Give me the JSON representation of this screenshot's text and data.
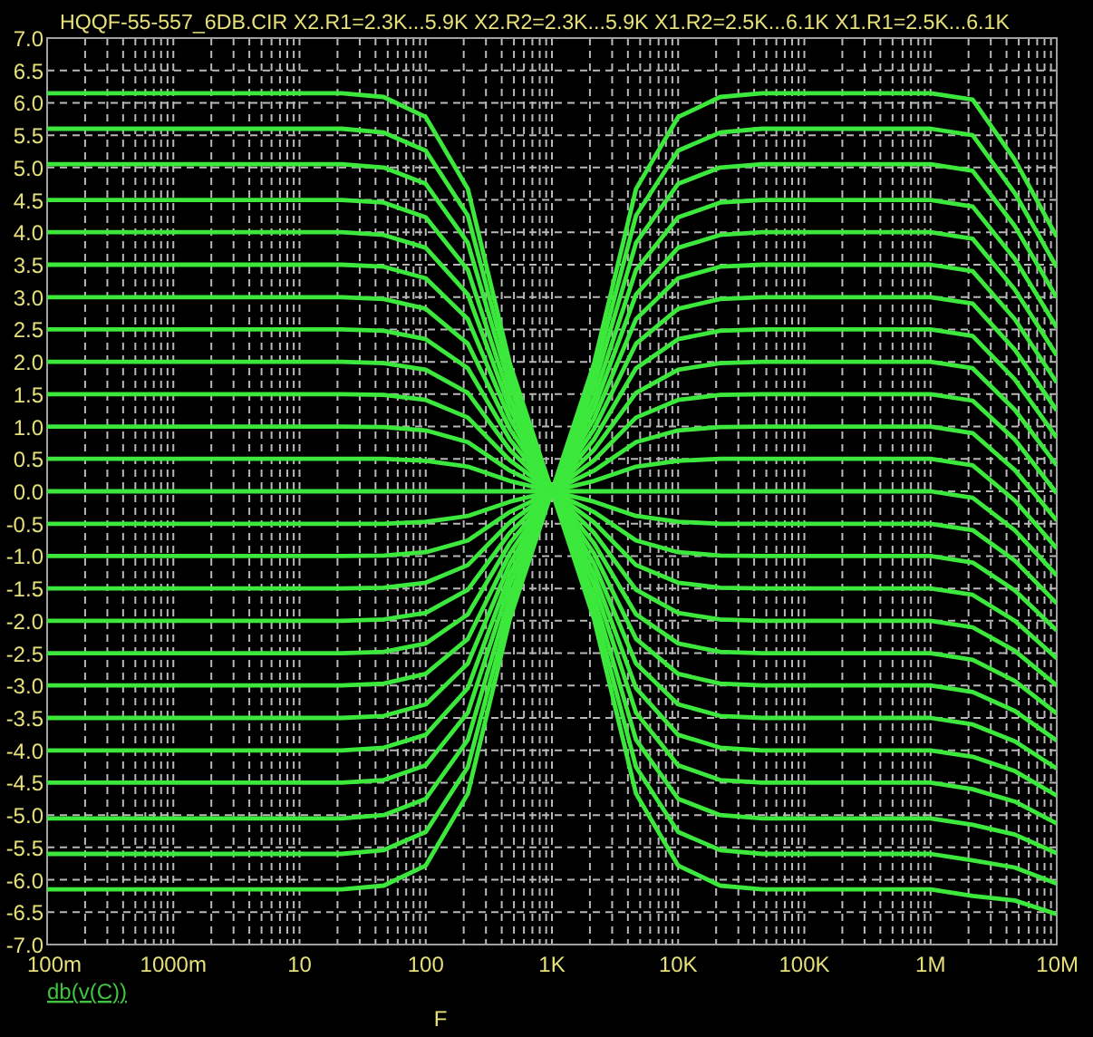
{
  "plot": {
    "chart_data": {
      "type": "line",
      "title": "HQQF-55-557_6DB.CIR X2.R1=2.3K...5.9K X2.R2=2.3K...5.9K X1.R2=2.5K...6.1K X1.R1=2.5K...6.1K",
      "xlabel": "F",
      "grid": true,
      "categories": [
        "100m",
        null,
        null,
        "1000m",
        null,
        null,
        "10",
        null,
        null,
        "100",
        null,
        null,
        "1K",
        null,
        null,
        "10K",
        null,
        null,
        "100K",
        null,
        null,
        "1M",
        null,
        null,
        "10M"
      ],
      "ylim": [
        -7,
        7
      ],
      "yticks": [
        {
          "value": 7,
          "label": "7.0"
        },
        {
          "value": 6.5,
          "label": "6.5"
        },
        {
          "value": 6,
          "label": "6.0"
        },
        {
          "value": 5.5,
          "label": "5.5"
        },
        {
          "value": 5,
          "label": "5.0"
        },
        {
          "value": 4.5,
          "label": "4.5"
        },
        {
          "value": 4,
          "label": "4.0"
        },
        {
          "value": 3.5,
          "label": "3.5"
        },
        {
          "value": 3,
          "label": "3.0"
        },
        {
          "value": 2.5,
          "label": "2.5"
        },
        {
          "value": 2,
          "label": "2.0"
        },
        {
          "value": 1.5,
          "label": "1.5"
        },
        {
          "value": 1,
          "label": "1.0"
        },
        {
          "value": 0.5,
          "label": "0.5"
        },
        {
          "value": 0,
          "label": "0.0"
        },
        {
          "value": -0.5,
          "label": "-0.5"
        },
        {
          "value": -1,
          "label": "-1.0"
        },
        {
          "value": -1.5,
          "label": "-1.5"
        },
        {
          "value": -2,
          "label": "-2.0"
        },
        {
          "value": -2.5,
          "label": "-2.5"
        },
        {
          "value": -3,
          "label": "-3.0"
        },
        {
          "value": -3.5,
          "label": "-3.5"
        },
        {
          "value": -4,
          "label": "-4.0"
        },
        {
          "value": -4.5,
          "label": "-4.5"
        },
        {
          "value": -5,
          "label": "-5.0"
        },
        {
          "value": -5.5,
          "label": "-5.5"
        },
        {
          "value": -6,
          "label": "-6.0"
        },
        {
          "value": -6.5,
          "label": "-6.5"
        },
        {
          "value": -7,
          "label": "-7.0"
        }
      ],
      "series": [
        {
          "color": "#3be83b",
          "values": [
            6.15,
            6.15,
            6.15,
            6.15,
            6.15,
            6.15,
            6.15,
            6.15,
            6.09,
            5.78,
            4.67,
            1.97,
            0,
            1.97,
            4.67,
            5.78,
            6.09,
            6.15,
            6.15,
            6.15,
            6.15,
            6.15,
            6.05,
            5.12,
            3.93
          ]
        },
        {
          "color": "#3be83b",
          "values": [
            5.6,
            5.6,
            5.6,
            5.6,
            5.6,
            5.6,
            5.6,
            5.6,
            5.54,
            5.26,
            4.26,
            1.79,
            0,
            1.79,
            4.26,
            5.26,
            5.54,
            5.6,
            5.6,
            5.6,
            5.6,
            5.6,
            5.5,
            4.61,
            3.46
          ]
        },
        {
          "color": "#3be83b",
          "values": [
            5.05,
            5.05,
            5.05,
            5.05,
            5.05,
            5.05,
            5.05,
            5.05,
            5.0,
            4.75,
            3.84,
            1.62,
            0,
            1.62,
            3.84,
            4.75,
            5.0,
            5.05,
            5.05,
            5.05,
            5.05,
            5.05,
            4.95,
            4.1,
            2.99
          ]
        },
        {
          "color": "#3be83b",
          "values": [
            4.5,
            4.5,
            4.5,
            4.5,
            4.5,
            4.5,
            4.5,
            4.5,
            4.46,
            4.23,
            3.42,
            1.44,
            0,
            1.44,
            3.42,
            4.23,
            4.46,
            4.5,
            4.5,
            4.5,
            4.5,
            4.5,
            4.4,
            3.59,
            2.53
          ]
        },
        {
          "color": "#3be83b",
          "values": [
            4,
            4,
            4,
            4,
            4,
            4,
            4,
            4,
            3.96,
            3.76,
            3.04,
            1.28,
            0,
            1.28,
            3.04,
            3.76,
            3.96,
            4,
            4,
            4,
            4,
            4,
            3.9,
            3.12,
            2.1
          ]
        },
        {
          "color": "#3be83b",
          "values": [
            3.5,
            3.5,
            3.5,
            3.5,
            3.5,
            3.5,
            3.5,
            3.5,
            3.47,
            3.29,
            2.66,
            1.12,
            0,
            1.12,
            2.66,
            3.29,
            3.47,
            3.5,
            3.5,
            3.5,
            3.5,
            3.5,
            3.4,
            2.66,
            1.68
          ]
        },
        {
          "color": "#3be83b",
          "values": [
            3,
            3,
            3,
            3,
            3,
            3,
            3,
            3,
            2.97,
            2.82,
            2.28,
            0.96,
            0,
            0.96,
            2.28,
            2.82,
            2.97,
            3,
            3,
            3,
            3,
            3,
            2.9,
            2.19,
            1.25
          ]
        },
        {
          "color": "#3be83b",
          "values": [
            2.5,
            2.5,
            2.5,
            2.5,
            2.5,
            2.5,
            2.5,
            2.5,
            2.48,
            2.35,
            1.9,
            0.8,
            0,
            0.8,
            1.9,
            2.35,
            2.48,
            2.5,
            2.5,
            2.5,
            2.5,
            2.5,
            2.4,
            1.73,
            0.83
          ]
        },
        {
          "color": "#3be83b",
          "values": [
            2,
            2,
            2,
            2,
            2,
            2,
            2,
            2,
            1.98,
            1.88,
            1.52,
            0.64,
            0,
            0.64,
            1.52,
            1.88,
            1.98,
            2,
            2,
            2,
            2,
            2,
            1.9,
            1.26,
            0.4
          ]
        },
        {
          "color": "#3be83b",
          "values": [
            1.5,
            1.5,
            1.5,
            1.5,
            1.5,
            1.5,
            1.5,
            1.5,
            1.49,
            1.41,
            1.14,
            0.48,
            0,
            0.48,
            1.14,
            1.41,
            1.49,
            1.5,
            1.5,
            1.5,
            1.5,
            1.5,
            1.4,
            0.8,
            -0.03
          ]
        },
        {
          "color": "#3be83b",
          "values": [
            1,
            1,
            1,
            1,
            1,
            1,
            1,
            1,
            0.99,
            0.94,
            0.76,
            0.32,
            0,
            0.32,
            0.76,
            0.94,
            0.99,
            1,
            1,
            1,
            1,
            1,
            0.9,
            0.33,
            -0.45
          ]
        },
        {
          "color": "#3be83b",
          "values": [
            0.5,
            0.5,
            0.5,
            0.5,
            0.5,
            0.5,
            0.5,
            0.5,
            0.5,
            0.47,
            0.38,
            0.16,
            0,
            0.16,
            0.38,
            0.47,
            0.5,
            0.5,
            0.5,
            0.5,
            0.5,
            0.5,
            0.4,
            -0.14,
            -0.88
          ]
        },
        {
          "color": "#3be83b",
          "values": [
            0,
            0,
            0,
            0,
            0,
            0,
            0,
            0,
            0,
            0,
            0,
            0,
            0,
            0,
            0,
            0,
            0,
            0,
            0,
            0,
            0,
            0,
            -0.1,
            -0.6,
            -1.3
          ]
        },
        {
          "color": "#3be83b",
          "values": [
            -0.5,
            -0.5,
            -0.5,
            -0.5,
            -0.5,
            -0.5,
            -0.5,
            -0.5,
            -0.5,
            -0.47,
            -0.38,
            -0.16,
            0,
            -0.16,
            -0.38,
            -0.47,
            -0.5,
            -0.5,
            -0.5,
            -0.5,
            -0.5,
            -0.5,
            -0.6,
            -1.07,
            -1.73
          ]
        },
        {
          "color": "#3be83b",
          "values": [
            -1,
            -1,
            -1,
            -1,
            -1,
            -1,
            -1,
            -1,
            -0.99,
            -0.94,
            -0.76,
            -0.32,
            0,
            -0.32,
            -0.76,
            -0.94,
            -0.99,
            -1,
            -1,
            -1,
            -1,
            -1,
            -1.1,
            -1.53,
            -2.15
          ]
        },
        {
          "color": "#3be83b",
          "values": [
            -1.5,
            -1.5,
            -1.5,
            -1.5,
            -1.5,
            -1.5,
            -1.5,
            -1.5,
            -1.49,
            -1.41,
            -1.14,
            -0.48,
            0,
            -0.48,
            -1.14,
            -1.41,
            -1.49,
            -1.5,
            -1.5,
            -1.5,
            -1.5,
            -1.5,
            -1.6,
            -2.0,
            -2.58
          ]
        },
        {
          "color": "#3be83b",
          "values": [
            -2,
            -2,
            -2,
            -2,
            -2,
            -2,
            -2,
            -2,
            -1.98,
            -1.88,
            -1.52,
            -0.64,
            0,
            -0.64,
            -1.52,
            -1.88,
            -1.98,
            -2,
            -2,
            -2,
            -2,
            -2,
            -2.1,
            -2.46,
            -3.0
          ]
        },
        {
          "color": "#3be83b",
          "values": [
            -2.5,
            -2.5,
            -2.5,
            -2.5,
            -2.5,
            -2.5,
            -2.5,
            -2.5,
            -2.48,
            -2.35,
            -1.9,
            -0.8,
            0,
            -0.8,
            -1.9,
            -2.35,
            -2.48,
            -2.5,
            -2.5,
            -2.5,
            -2.5,
            -2.5,
            -2.6,
            -2.93,
            -3.43
          ]
        },
        {
          "color": "#3be83b",
          "values": [
            -3,
            -3,
            -3,
            -3,
            -3,
            -3,
            -3,
            -3,
            -2.97,
            -2.82,
            -2.28,
            -0.96,
            0,
            -0.96,
            -2.28,
            -2.82,
            -2.97,
            -3,
            -3,
            -3,
            -3,
            -3,
            -3.1,
            -3.39,
            -3.85
          ]
        },
        {
          "color": "#3be83b",
          "values": [
            -3.5,
            -3.5,
            -3.5,
            -3.5,
            -3.5,
            -3.5,
            -3.5,
            -3.5,
            -3.47,
            -3.29,
            -2.66,
            -1.12,
            0,
            -1.12,
            -2.66,
            -3.29,
            -3.47,
            -3.5,
            -3.5,
            -3.5,
            -3.5,
            -3.5,
            -3.6,
            -3.86,
            -4.28
          ]
        },
        {
          "color": "#3be83b",
          "values": [
            -4,
            -4,
            -4,
            -4,
            -4,
            -4,
            -4,
            -4,
            -3.96,
            -3.76,
            -3.04,
            -1.28,
            0,
            -1.28,
            -3.04,
            -3.76,
            -3.96,
            -4,
            -4,
            -4,
            -4,
            -4,
            -4.1,
            -4.32,
            -4.7
          ]
        },
        {
          "color": "#3be83b",
          "values": [
            -4.5,
            -4.5,
            -4.5,
            -4.5,
            -4.5,
            -4.5,
            -4.5,
            -4.5,
            -4.46,
            -4.23,
            -3.42,
            -1.44,
            0,
            -1.44,
            -3.42,
            -4.23,
            -4.46,
            -4.5,
            -4.5,
            -4.5,
            -4.5,
            -4.5,
            -4.6,
            -4.79,
            -5.13
          ]
        },
        {
          "color": "#3be83b",
          "values": [
            -5.05,
            -5.05,
            -5.05,
            -5.05,
            -5.05,
            -5.05,
            -5.05,
            -5.05,
            -5.0,
            -4.75,
            -3.84,
            -1.62,
            0,
            -1.62,
            -3.84,
            -4.75,
            -5.0,
            -5.05,
            -5.05,
            -5.05,
            -5.05,
            -5.05,
            -5.15,
            -5.3,
            -5.59
          ]
        },
        {
          "color": "#3be83b",
          "values": [
            -5.6,
            -5.6,
            -5.6,
            -5.6,
            -5.6,
            -5.6,
            -5.6,
            -5.6,
            -5.54,
            -5.26,
            -4.26,
            -1.79,
            0,
            -1.79,
            -4.26,
            -5.26,
            -5.54,
            -5.6,
            -5.6,
            -5.6,
            -5.6,
            -5.6,
            -5.7,
            -5.81,
            -6.06
          ]
        },
        {
          "color": "#3be83b",
          "values": [
            -6.15,
            -6.15,
            -6.15,
            -6.15,
            -6.15,
            -6.15,
            -6.15,
            -6.15,
            -6.09,
            -5.78,
            -4.67,
            -1.97,
            0,
            -1.97,
            -4.67,
            -5.78,
            -6.09,
            -6.15,
            -6.15,
            -6.15,
            -6.15,
            -6.15,
            -6.25,
            -6.32,
            -6.53
          ]
        }
      ]
    },
    "trace_label": "db(v(C))"
  }
}
